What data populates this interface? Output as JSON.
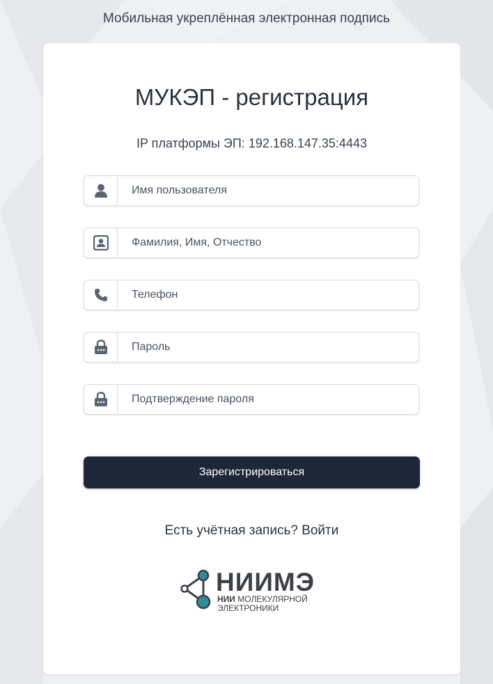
{
  "app": {
    "title": "Мобильная укреплённая электронная подпись"
  },
  "form": {
    "heading": "МУКЭП - регистрация",
    "ip_line": "IP платформы ЭП: 192.168.147.35:4443",
    "fields": [
      {
        "icon": "user-icon",
        "placeholder": "Имя пользователя",
        "value": ""
      },
      {
        "icon": "contact-card-icon",
        "placeholder": "Фамилия, Имя, Отчество",
        "value": ""
      },
      {
        "icon": "phone-icon",
        "placeholder": "Телефон",
        "value": ""
      },
      {
        "icon": "lock-icon",
        "placeholder": "Пароль",
        "value": ""
      },
      {
        "icon": "lock-icon",
        "placeholder": "Подтверждение пароля",
        "value": ""
      }
    ],
    "submit_label": "Зарегистрироваться",
    "login_prompt": "Есть учётная запись? ",
    "login_link": "Войти"
  },
  "logo": {
    "name": "НИИМЭ",
    "sub_bold": "НИИ",
    "sub_line1": "МОЛЕКУЛЯРНОЙ",
    "sub_line2": "ЭЛЕКТРОНИКИ"
  },
  "colors": {
    "button_bg": "#1e2737",
    "icon": "#5b6472",
    "logo_accent": "#2f8c99",
    "background": "#eef0f3"
  }
}
